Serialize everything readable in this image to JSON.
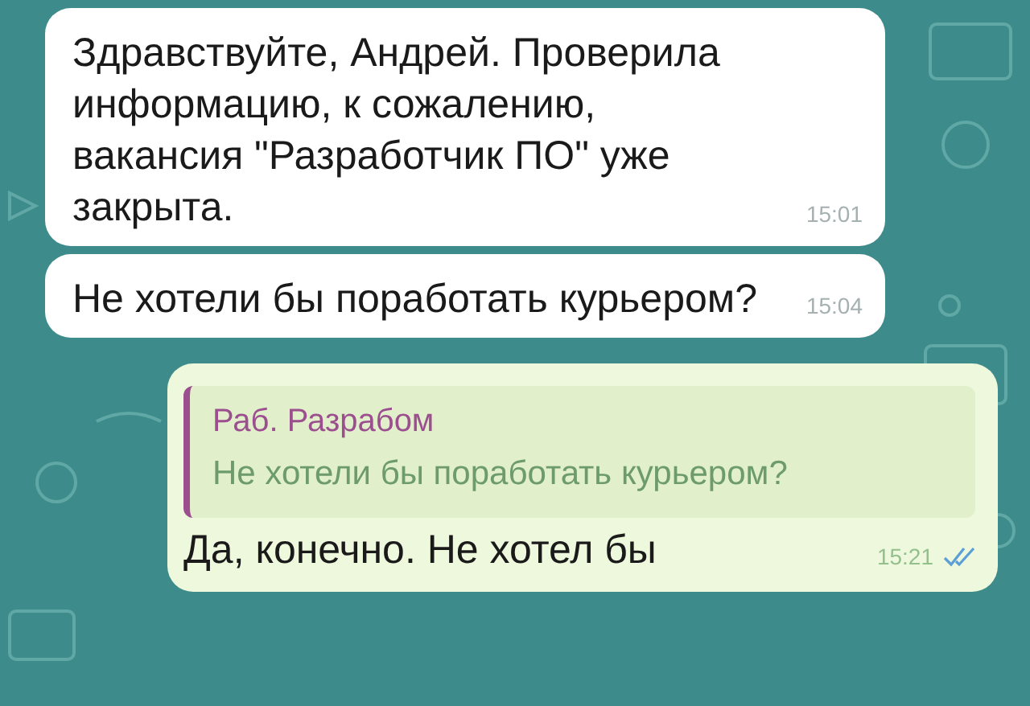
{
  "messages": [
    {
      "kind": "incoming",
      "text": "Здравствуйте, Андрей. Проверила информацию, к сожалению, вакансия \"Разработчик ПО\" уже закрыта.",
      "time": "15:01"
    },
    {
      "kind": "incoming",
      "text": "Не хотели бы поработать курьером?",
      "time": "15:04"
    },
    {
      "kind": "outgoing",
      "reply": {
        "author": "Раб. Разрабом",
        "text": "Не хотели бы поработать курьером?"
      },
      "text": "Да, конечно. Не хотел бы",
      "time": "15:21",
      "read": true
    }
  ]
}
